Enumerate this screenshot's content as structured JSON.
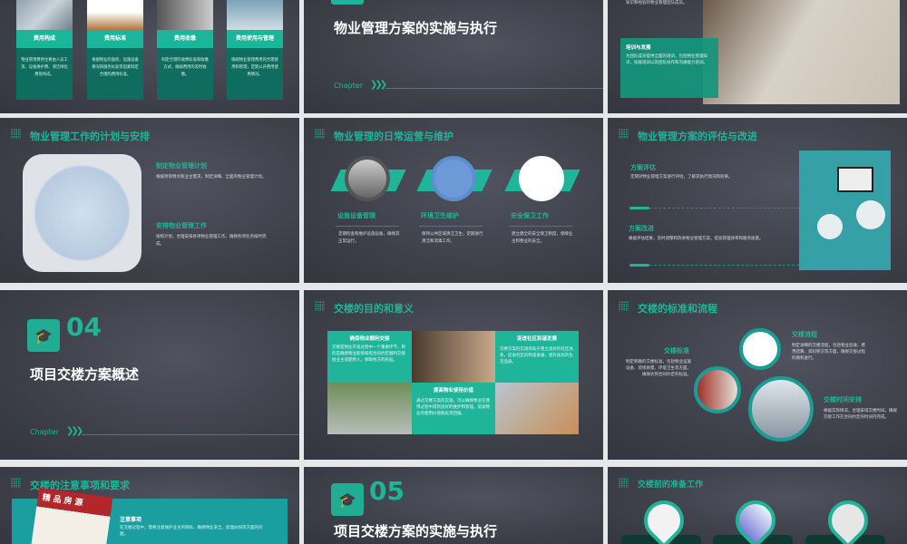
{
  "slides": [
    {
      "cards": [
        {
          "title": "费用构成",
          "text": "物业管理费用主要由人员工资、设备维护费、清洁绿化费等构成。"
        },
        {
          "title": "费用标准",
          "text": "根据物业的面积、设施设备情况和服务标准等因素制定合理的费用标准。"
        },
        {
          "title": "费用收缴",
          "text": "制定合理的收费标准和收缴方式，确保费用的及时收缴。"
        },
        {
          "title": "费用使用与管理",
          "text": "确保物业管理费用的合理使用和管理，定期公开费用使用情况。"
        }
      ]
    },
    {
      "title": "物业管理方案的实施与执行",
      "chapter": "Chapter"
    },
    {
      "top_text": "知识和经验的物业管理团队成员。",
      "box_title": "培训与发展",
      "box_text": "为团队成员提供全面的培训，包括物业管理知识、技能培训以及团队协作和沟通能力培训。"
    },
    {
      "title": "物业管理工作的计划与安排",
      "items": [
        {
          "heading": "制定物业管理计划",
          "text": "根据项目特点和业主需求，制定详细、全面的物业管理计划。"
        },
        {
          "heading": "安排物业管理工作",
          "text": "按照计划，合理安排各项物业管理工作，确保各项任务按时完成。"
        }
      ]
    },
    {
      "title": "物业管理的日常运营与维护",
      "items": [
        {
          "heading": "设施设备管理",
          "text": "定期检查和维护设施设备，确保其正常运行。"
        },
        {
          "heading": "环境卫生维护",
          "text": "保持公共区域清洁卫生，定期进行清洁和消毒工作。"
        },
        {
          "heading": "安全保卫工作",
          "text": "建立健全的安全保卫制度，保障业主和物业的安全。"
        }
      ]
    },
    {
      "title": "物业管理方案的评估与改进",
      "items": [
        {
          "heading": "方案评估",
          "text": "定期对物业管理方案进行评估，了解其执行情况和效果。"
        },
        {
          "heading": "方案改进",
          "text": "根据评估结果，及时调整和改进物业管理方案，提高管理效率和服务质量。"
        }
      ]
    },
    {
      "number": "04",
      "title": "项目交楼方案概述",
      "chapter": "Chapter"
    },
    {
      "title": "交楼的目的和意义",
      "items": [
        {
          "heading": "确保物业顺利交接",
          "text": "交楼是物业开发过程中一个重要环节，目的是确保物业能够按照合同约定顺利交接给业主或使用人，保障各方的权益。"
        },
        {
          "heading": "促进社区和谐发展",
          "text": "交楼方案的实施有助于建立良好的社区关系，促进社区的和谐发展，提升居民的生活品质。"
        },
        {
          "heading": "提高物业使用价值",
          "text": "通过交楼方案的实施，可以确保物业在使用过程中得到良好的维护和管理，提高物业的使用价值和投资回报。"
        }
      ]
    },
    {
      "title": "交楼的标准和流程",
      "items": [
        {
          "heading": "交楼标准",
          "text": "制定明确的交楼标准，包括物业设施设备、装修质量、环境卫生等方面，确保达到合同约定的标准。"
        },
        {
          "heading": "交楼流程",
          "text": "制定详细的交楼流程，包括物业验收、费用结算、资料移交等方面，确保交接过程的顺利进行。"
        },
        {
          "heading": "交楼时间安排",
          "text": "根据实际情况，合理安排交楼时间，确保交接工作在合同约定的时间内完成。"
        }
      ]
    },
    {
      "title": "交楼的注意事项和要求",
      "sign": "精品房源",
      "heading": "注意事项",
      "text": "在交楼过程中，需要注意保护业主的隐私，确保物业安全，处理纠纷等方面的问题。"
    },
    {
      "number": "05",
      "title": "项目交楼方案的实施与执行"
    },
    {
      "title": "交楼前的准备工作"
    }
  ]
}
